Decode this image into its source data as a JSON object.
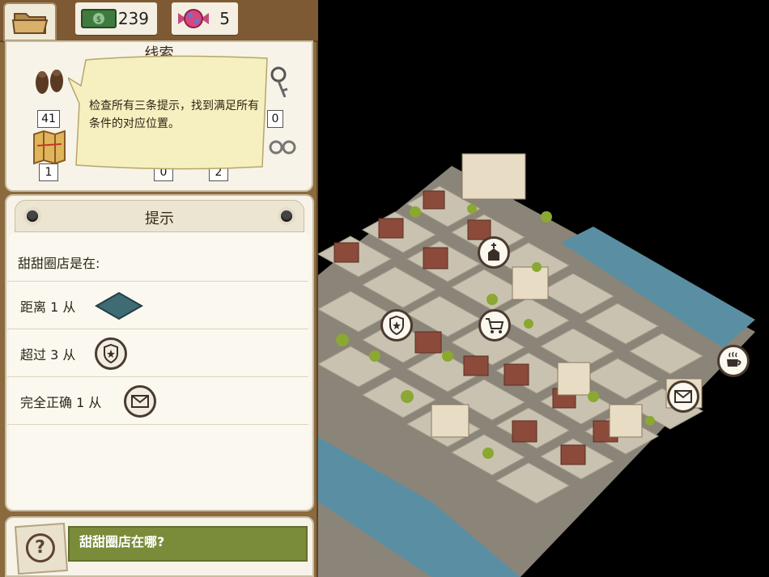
{
  "currency": {
    "cash_amount": "239",
    "candy_amount": "5"
  },
  "clues_panel": {
    "title": "线索",
    "items": [
      {
        "icon": "footprints-icon",
        "count": "41"
      },
      {
        "icon": "keys-icon",
        "count": "0"
      },
      {
        "icon": "map-icon",
        "count": "1"
      },
      {
        "icon": "gear-icon",
        "count": "0"
      },
      {
        "icon": "handcuffs-icon",
        "count": "2"
      }
    ]
  },
  "tooltip": {
    "text": "检查所有三条提示，找到满足所有条件的对应位置。"
  },
  "hints_panel": {
    "title": "提示",
    "subject": "甜甜圈店是在:",
    "rows": [
      {
        "text": "距离 1 从",
        "icon": "water-tile-icon"
      },
      {
        "text": "超过 3 从",
        "icon": "police-badge-icon"
      },
      {
        "text": "完全正确 1 从",
        "icon": "mail-icon"
      }
    ]
  },
  "question": {
    "text": "甜甜圈店在哪?",
    "icon": "question-mark-icon"
  },
  "map_icons": [
    {
      "name": "church-icon"
    },
    {
      "name": "police-badge-icon"
    },
    {
      "name": "shopping-cart-icon"
    },
    {
      "name": "coffee-icon"
    },
    {
      "name": "mail-icon"
    }
  ],
  "colors": {
    "panel_wood": "#8a6a3e",
    "paper": "#f7f3e8",
    "accent_green": "#7a8c3a",
    "water": "#5a8fa3",
    "road": "#8b8478",
    "block": "#c9c2b0"
  }
}
